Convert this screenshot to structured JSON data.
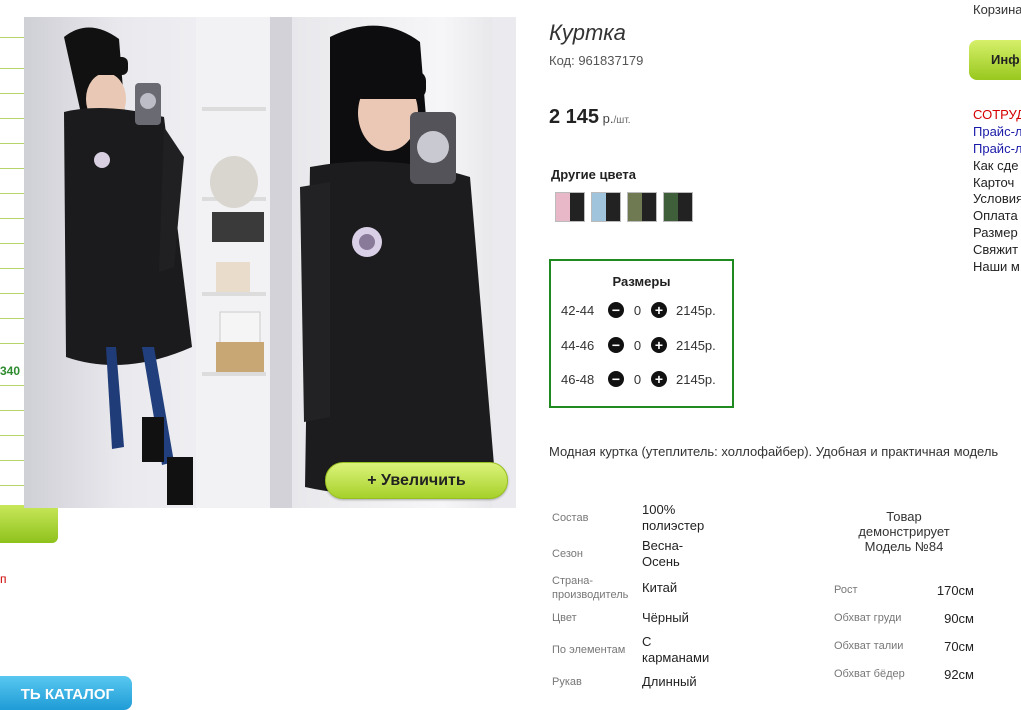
{
  "left_rail": {
    "price_fragment": "340",
    "red_fragment": "п",
    "catalog_button": "ТЬ КАТАЛОГ"
  },
  "gallery": {
    "zoom_button": "+  Увеличить"
  },
  "product": {
    "title": "Куртка",
    "code": "Код: 961837179",
    "price_value": "2 145",
    "price_unit": " р.",
    "price_per": "/шт.",
    "other_colors_label": "Другие цвета",
    "swatches": [
      "#e8b8c8",
      "#9fc4dc",
      "#6f7a52",
      "#3e5f3a"
    ]
  },
  "sizes": {
    "title": "Размеры",
    "rows": [
      {
        "size": "42-44",
        "qty": "0",
        "price": "2145р."
      },
      {
        "size": "44-46",
        "qty": "0",
        "price": "2145р."
      },
      {
        "size": "46-48",
        "qty": "0",
        "price": "2145р."
      }
    ],
    "minus": "−",
    "plus": "+"
  },
  "description": "Модная куртка (утеплитель: холлофайбер). Удобная и практичная модель",
  "specs": [
    {
      "label": "Состав",
      "value": "100% полиэстер"
    },
    {
      "label": "Сезон",
      "value": "Весна-Осень"
    },
    {
      "label": "Страна-производитель",
      "value": "Китай"
    },
    {
      "label": "Цвет",
      "value": "Чёрный"
    },
    {
      "label": "По элементам",
      "value": "С карманами"
    },
    {
      "label": "Рукав",
      "value": "Длинный"
    }
  ],
  "model": {
    "title": "Товар демонстрирует Модель №84",
    "rows": [
      {
        "label": "Рост",
        "value": "170см"
      },
      {
        "label": "Обхват груди",
        "value": "90см"
      },
      {
        "label": "Обхват талии",
        "value": "70см"
      },
      {
        "label": "Обхват бёдер",
        "value": "92см"
      }
    ]
  },
  "right_column": {
    "cart": "Корзина",
    "info_button": "Инф",
    "links": [
      "СОТРУД",
      "Прайс-л",
      "Прайс-л",
      "Как сде",
      "Карточ",
      "Условия",
      "Оплата",
      "Размер",
      "Свяжит",
      "Наши м"
    ]
  },
  "colors": {
    "accent_green": "#a6d12a",
    "sizes_border": "#1f8a1f",
    "catalog_blue": "#1f9bd6"
  }
}
